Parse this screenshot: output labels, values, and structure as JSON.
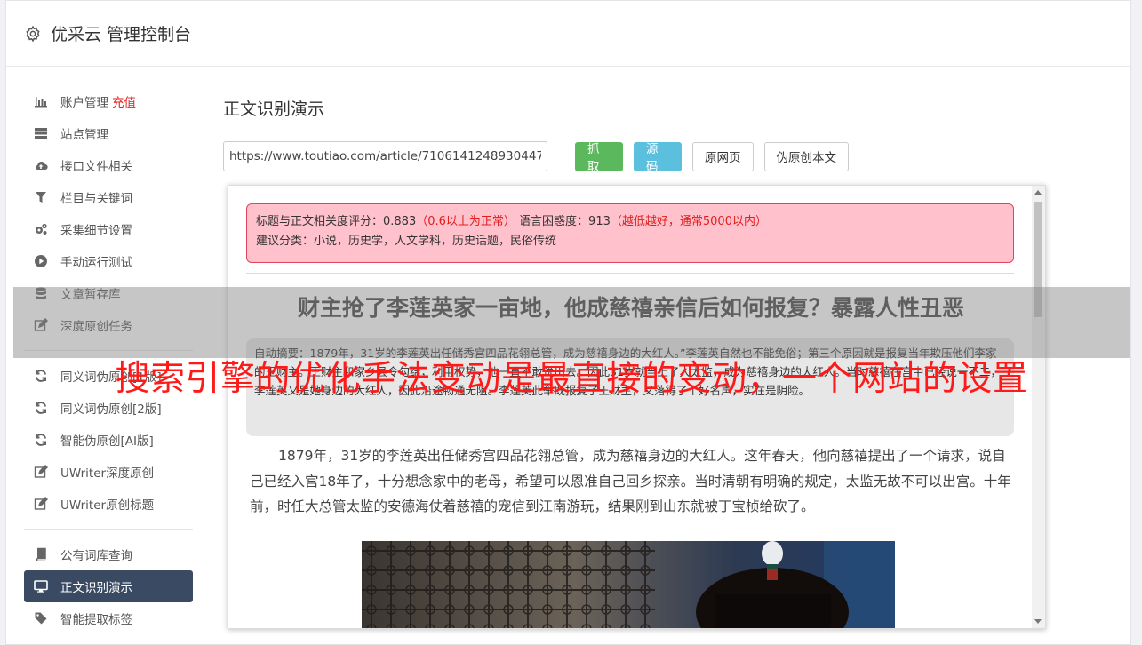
{
  "header": {
    "title": "优采云 管理控制台",
    "icon": "gear-icon"
  },
  "sidebar": {
    "items": [
      {
        "label": "账户管理",
        "extra": "充值",
        "icon": "bar-chart-icon"
      },
      {
        "label": "站点管理",
        "icon": "server-icon"
      },
      {
        "label": "接口文件相关",
        "icon": "cloud-upload-icon"
      },
      {
        "label": "栏目与关键词",
        "icon": "filter-icon"
      },
      {
        "label": "采集细节设置",
        "icon": "cogs-icon"
      },
      {
        "label": "手动运行测试",
        "icon": "play-circle-icon"
      },
      {
        "label": "文章暂存库",
        "icon": "database-icon"
      },
      {
        "label": "深度原创任务",
        "icon": "edit-icon"
      },
      {
        "label": "同义词伪原创[1版]",
        "icon": "refresh-icon"
      },
      {
        "label": "同义词伪原创[2版]",
        "icon": "refresh-icon"
      },
      {
        "label": "智能伪原创[AI版]",
        "icon": "refresh-icon"
      },
      {
        "label": "UWriter深度原创",
        "icon": "edit-icon"
      },
      {
        "label": "UWriter原创标题",
        "icon": "edit-icon"
      },
      {
        "label": "公有词库查询",
        "icon": "book-icon"
      },
      {
        "label": "正文识别演示",
        "icon": "desktop-icon"
      },
      {
        "label": "智能提取标签",
        "icon": "tag-icon"
      }
    ]
  },
  "main": {
    "title": "正文识别演示",
    "url_value": "https://www.toutiao.com/article/7106141248930447",
    "buttons": {
      "fetch": "抓取",
      "source": "源码",
      "original": "原网页",
      "rewrite": "伪原创本文"
    }
  },
  "result": {
    "score_line_prefix": "标题与正文相关度评分：0.883",
    "score_note": "（0.6以上为正常）",
    "perplexity_prefix": "语言困惑度：913",
    "perplexity_note": "（越低越好，通常5000以内）",
    "category_line": "建议分类：小说，历史学，人文学科，历史话题，民俗传统",
    "article_title": "财主抢了李莲英家一亩地，他成慈禧亲信后如何报复？暴露人性丑恶",
    "summary": "自动摘要：1879年，31岁的李莲英出任储秀宫四品花翎总管，成为慈禧身边的大红人。”李莲英自然也不能免俗；第三个原因就是报复当年欺压他们李家的王财主。王财主和家乡县令勾结，利用权势，他一直不敢说出去。因此31岁就当上了大太监，成为慈禧身边的大红人。当时慈禧在宫中已经说一不二，李莲英又是她身边的大红人，因此沿途畅通无阻。李莲英此举既报复了王财主，又落得了个好名声，实在是阴险。",
    "body": "1879年，31岁的李莲英出任储秀宫四品花翎总管，成为慈禧身边的大红人。这年春天，他向慈禧提出了一个请求，说自己已经入宫18年了，十分想念家中的老母，希望可以恩准自己回乡探亲。当时清朝有明确的规定，太监无故不可以出宫。十年前，时任大总管太监的安德海仗着慈禧的宠信到江南游玩，结果刚到山东就被丁宝桢给砍了。"
  },
  "overlay": {
    "text": "搜索引擎的优化手法变动是最直接的变动，一个网站的设置"
  }
}
